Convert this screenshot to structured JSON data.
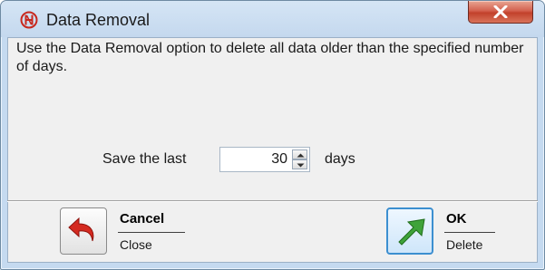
{
  "window": {
    "title": "Data Removal",
    "icon": "app-logo-icon",
    "close_icon": "close-icon"
  },
  "message": "Use the Data Removal option to delete all data older than the specified number of days.",
  "retention": {
    "prefix": "Save the last",
    "value": "30",
    "suffix": "days"
  },
  "actions": {
    "cancel": {
      "title": "Cancel",
      "subtitle": "Close",
      "icon": "undo-arrow-icon"
    },
    "ok": {
      "title": "OK",
      "subtitle": "Delete",
      "icon": "go-arrow-icon"
    }
  },
  "colors": {
    "accent": "#3c8fd0",
    "close": "#c2412b",
    "cancel_icon": "#d42a20",
    "ok_icon": "#3fa33a"
  }
}
